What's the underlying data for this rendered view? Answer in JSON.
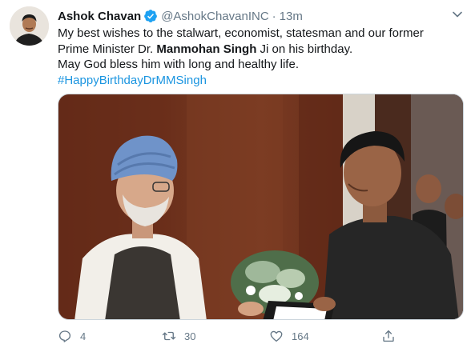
{
  "tweet": {
    "author_name": "Ashok Chavan",
    "author_handle": "@AshokChavanINC",
    "separator": "·",
    "time": "13m",
    "text_line1": "My best wishes to the stalwart, economist, statesman and our former",
    "text_line2_pre": "Prime Minister Dr. ",
    "text_line2_bold": "Manmohan Singh",
    "text_line2_post": " Ji on his birthday.",
    "text_line3": "May God bless him with long and healthy life.",
    "hashtag": "#HappyBirthdayDrMMSingh"
  },
  "actions": {
    "reply_count": "4",
    "retweet_count": "30",
    "like_count": "164"
  },
  "colors": {
    "link": "#1b95e0",
    "verified": "#1da1f2",
    "muted": "#657786"
  },
  "icons": [
    "verified-badge-icon",
    "chevron-down-icon",
    "reply-icon",
    "retweet-icon",
    "like-icon",
    "share-icon"
  ]
}
